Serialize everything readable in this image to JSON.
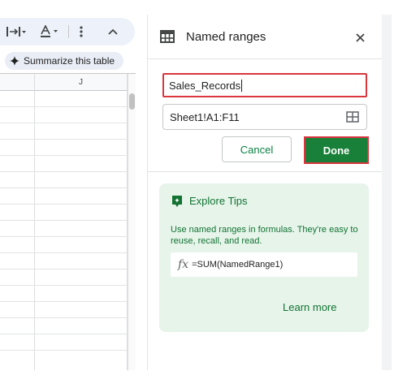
{
  "sheet": {
    "column_header": "J",
    "summarize_chip": {
      "label": "Summarize this table",
      "icon": "sparkle-icon"
    },
    "toolbar": {
      "icons": [
        "text-direction-icon",
        "text-color-icon",
        "more-vert-icon",
        "chevron-up-icon"
      ]
    }
  },
  "panel": {
    "title": "Named ranges",
    "title_icon": "table-icon",
    "close_icon": "close-icon",
    "name_value": "Sales_Records",
    "range_value": "Sheet1!A1:F11",
    "range_icon": "grid-icon",
    "cancel_label": "Cancel",
    "done_label": "Done",
    "tips": {
      "title": "Explore Tips",
      "icon": "explore-tips-icon",
      "text": "Use named ranges in formulas. They're easy to reuse, recall, and read.",
      "fx_symbol": "fx",
      "formula": "=SUM(NamedRange1)",
      "learn_more": "Learn more"
    }
  },
  "colors": {
    "accent_green": "#188038",
    "tips_background": "#e6f4ea",
    "highlight_red": "#d9363e"
  }
}
